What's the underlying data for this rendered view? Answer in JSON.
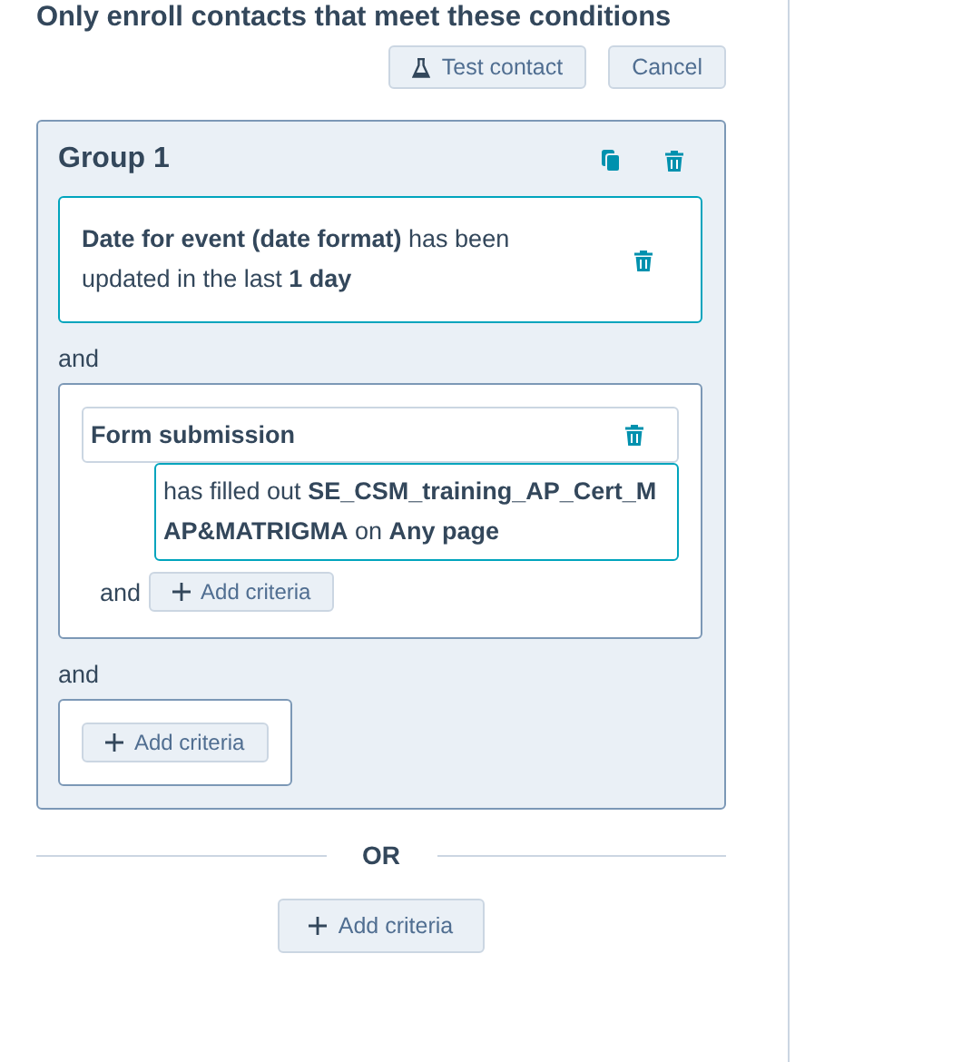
{
  "heading": "Only enroll contacts that meet these conditions",
  "actions": [
    {
      "kind": "test",
      "label": "Test contact"
    },
    {
      "kind": "plain",
      "label": "Cancel"
    }
  ],
  "group": {
    "title": "Group 1",
    "criteria": [
      {
        "kind": "filter",
        "text": "**Date for event (date format)** has been updated in the last **1 day**"
      },
      {
        "kind": "form",
        "joiner": "and",
        "title": "Form submission",
        "text": "has filled out **SE_CSM_training_AP_Cert_MAP&MATRIGMA** on **Any page**",
        "inner_joiner": "and",
        "add_label": "Add criteria"
      },
      {
        "kind": "empty",
        "joiner": "and",
        "add_label": "Add criteria"
      }
    ]
  },
  "or_label": "OR",
  "add_label": "Add criteria"
}
